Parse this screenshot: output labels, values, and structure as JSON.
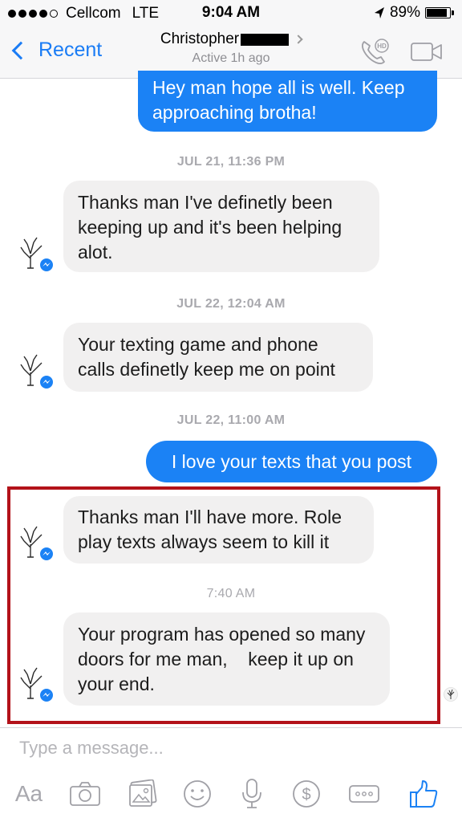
{
  "status": {
    "carrier": "Cellcom",
    "network": "LTE",
    "time": "9:04 AM",
    "battery_percent": "89%",
    "battery_level": 0.89
  },
  "header": {
    "back_label": "Recent",
    "contact_name": "Christopher",
    "active_status": "Active 1h ago",
    "call_icon": "phone-hd-icon",
    "video_icon": "video-camera-icon"
  },
  "messages": {
    "m1": "Hey man hope all is well. Keep approaching brotha!",
    "ts1": "JUL 21, 11:36 PM",
    "m2": "Thanks man I've definetly been keeping up and it's been helping alot.",
    "ts2": "JUL 22, 12:04 AM",
    "m3": "Your texting game and phone calls definetly keep me on point",
    "ts3": "JUL 22, 11:00 AM",
    "m4": "I love your texts that you post",
    "m5": "Thanks man I'll have more. Role play texts always seem to kill it",
    "ts4": "7:40 AM",
    "m6": "Your program has opened so many doors for me man,    keep it up on your end."
  },
  "composer": {
    "placeholder": "Type a message...",
    "aa_label": "Aa"
  },
  "colors": {
    "accent": "#1b82f5",
    "incoming_bubble": "#f1f0f0",
    "highlight_border": "#b3121a"
  }
}
